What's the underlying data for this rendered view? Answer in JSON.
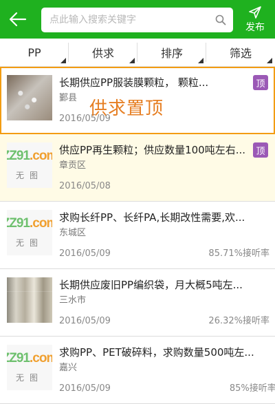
{
  "header": {
    "search_placeholder": "点此输入搜索关键字",
    "publish_label": "发布",
    "accent": "#1fb11f"
  },
  "filters": [
    {
      "label": "PP"
    },
    {
      "label": "供求"
    },
    {
      "label": "排序"
    },
    {
      "label": "筛选"
    }
  ],
  "overlay_label": "供求置顶",
  "noimg": {
    "logo": "ZZ91",
    "logo_tail": ".com",
    "text": "无图"
  },
  "items": [
    {
      "title": "长期供应PP服装膜颗粒， 颗粒...",
      "location": "鄞县",
      "date": "2016/05/09",
      "rate": "",
      "badge": "顶",
      "thumb": "photo-pellet"
    },
    {
      "title": "供应PP再生颗粒；供应数量100吨左右...",
      "location": "章贡区",
      "date": "2016/05/08",
      "rate": "",
      "badge": "顶",
      "thumb": "noimg"
    },
    {
      "title": "求购长纤PP、长纤PA,长期改性需要,欢...",
      "location": "东城区",
      "date": "2016/05/09",
      "rate": "85.71%接听率",
      "badge": "",
      "thumb": "noimg"
    },
    {
      "title": "长期供应废旧PP编织袋，月大概5吨左...",
      "location": "三水市",
      "date": "2016/05/09",
      "rate": "26.32%接听率",
      "badge": "",
      "thumb": "photo-bags"
    },
    {
      "title": "求购PP、PET破碎料，求购数量500吨左...",
      "location": "嘉兴",
      "date": "2016/05/09",
      "rate": "85%接听率",
      "badge": "",
      "thumb": "noimg"
    }
  ]
}
